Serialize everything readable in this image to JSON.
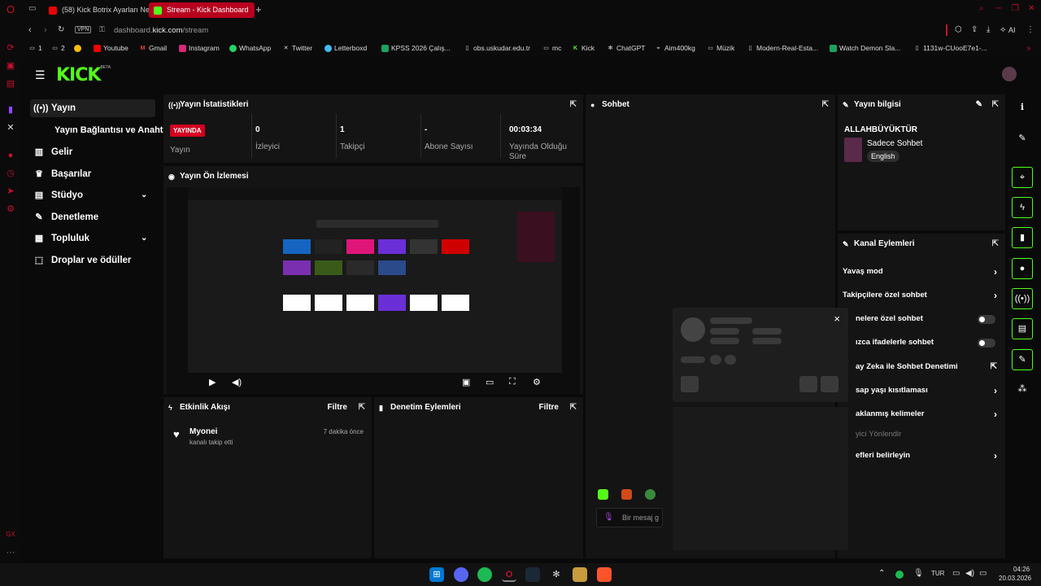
{
  "colors": {
    "kick_green": "#53fc18",
    "opera_red": "#c8102e",
    "live_red": "#d1001f"
  },
  "browser": {
    "tabs": [
      {
        "label": "(58) Kick Botrix Ayarları Ne",
        "icon": "youtube-icon"
      },
      {
        "label": "Stream - Kick Dashboard",
        "icon": "kick-icon"
      }
    ],
    "new_tab": "+",
    "vpn": "VPN",
    "url_host": "dashboard.",
    "url_domain": "kick.com",
    "url_path": "/stream",
    "ai_label": "AI",
    "bookmarks": [
      "1",
      "2",
      "Youtube",
      "Gmail",
      "Instagram",
      "WhatsApp",
      "Twitter",
      "Letterboxd",
      "KPSS 2026 Çalış...",
      "obs.uskudar.edu.tr",
      "mc",
      "Kick",
      "ChatGPT",
      "Aim400kg",
      "Müzik",
      "Modern-Real-Esta...",
      "Watch Demon Sla...",
      "1131w-CUooE7e1-..."
    ]
  },
  "kick": {
    "logo": "KICK",
    "beta": "BETA",
    "nav": [
      {
        "label": "Yayın",
        "icon": "broadcast-icon"
      },
      {
        "label": "Yayın Bağlantısı ve Anahtarı",
        "icon": ""
      },
      {
        "label": "Gelir",
        "icon": "chart-icon"
      },
      {
        "label": "Başarılar",
        "icon": "trophy-icon"
      },
      {
        "label": "Stüdyo",
        "icon": "studio-icon"
      },
      {
        "label": "Denetleme",
        "icon": "wrench-icon"
      },
      {
        "label": "Topluluk",
        "icon": "community-icon"
      },
      {
        "label": "Droplar ve ödüller",
        "icon": "drops-icon"
      }
    ],
    "stats": {
      "title": "Yayın İstatistikleri",
      "live_badge": "YAYINDA",
      "items": [
        {
          "value": "",
          "label": "Yayın"
        },
        {
          "value": "0",
          "label": "İzleyici"
        },
        {
          "value": "1",
          "label": "Takipçi"
        },
        {
          "value": "-",
          "label": "Abone Sayısı"
        },
        {
          "value": "00:03:34",
          "label": "Yayında Olduğu Süre"
        }
      ]
    },
    "preview": {
      "title": "Yayın Ön İzlemesi"
    },
    "activity": {
      "title": "Etkinlik Akışı",
      "filter": "Filtre",
      "user": "Myonei",
      "action": "kanalı takip etti",
      "time": "7 dakika önce"
    },
    "moderation": {
      "title": "Denetim Eylemleri",
      "filter": "Filtre"
    },
    "chat": {
      "title": "Sohbet",
      "placeholder": "Bir mesaj g"
    },
    "info": {
      "title": "Yayın bilgisi",
      "stream_title": "ALLAHBÜYÜKTÜR",
      "category": "Sadece Sohbet",
      "language": "English"
    },
    "channel": {
      "title": "Kanal Eylemleri",
      "items": [
        {
          "label": "Yavaş mod",
          "ctrl": "chevron"
        },
        {
          "label": "Takipçilere özel sohbet",
          "ctrl": "chevron"
        },
        {
          "label": "nelere özel sohbet",
          "ctrl": "toggle"
        },
        {
          "label": "ızca ifadelerle sohbet",
          "ctrl": "toggle"
        },
        {
          "label": "ay Zeka ile Sohbet Denetimi",
          "ctrl": "external"
        },
        {
          "label": "sap yaşı kısıtlaması",
          "ctrl": "chevron"
        },
        {
          "label": "aklanmış kelimeler",
          "ctrl": "chevron"
        },
        {
          "label": "yici Yönlendir",
          "ctrl": "none"
        },
        {
          "label": "efleri belirleyin",
          "ctrl": "chevron"
        }
      ]
    },
    "popup": {
      "close": "×"
    }
  },
  "taskbar": {
    "lang": "TUR",
    "time": "04:26",
    "date": "20.03.2026"
  }
}
